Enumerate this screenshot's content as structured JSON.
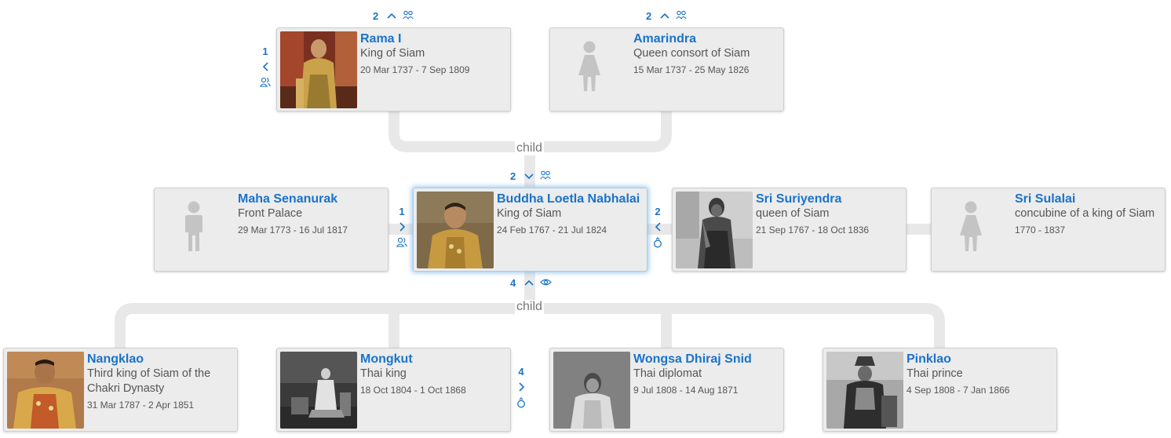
{
  "rel_labels": {
    "top": "child",
    "bottom": "child"
  },
  "controls": {
    "rama_parents_count": "2",
    "amarindra_parents_count": "2",
    "rama_spouses_count": "1",
    "center_parents_count": "2",
    "center_children_count": "4",
    "center_spouse_left_count": "1",
    "center_spouse_right_count": "2",
    "mongkut_spouses_count": "4"
  },
  "cards": {
    "rama": {
      "name": "Rama I",
      "desc": "King of Siam",
      "dates": "20 Mar 1737 - 7 Sep 1809"
    },
    "amarindra": {
      "name": "Amarindra",
      "desc": "Queen consort of Siam",
      "dates": "15 Mar 1737 - 25 May 1826"
    },
    "senanurak": {
      "name": "Maha Senanurak",
      "desc": "Front Palace",
      "dates": "29 Mar 1773 - 16 Jul 1817"
    },
    "buddha": {
      "name": "Buddha Loetla Nabhalai",
      "desc": "King of Siam",
      "dates": "24 Feb 1767 - 21 Jul 1824"
    },
    "suriyendra": {
      "name": "Sri Suriyendra",
      "desc": "queen of Siam",
      "dates": "21 Sep 1767 - 18 Oct 1836"
    },
    "sulalai": {
      "name": "Sri Sulalai",
      "desc": "concubine of a king of Siam",
      "dates": "1770 - 1837"
    },
    "nangklao": {
      "name": "Nangklao",
      "desc": "Third king of Siam of the Chakri Dynasty",
      "dates": "31 Mar 1787 - 2 Apr 1851"
    },
    "mongkut": {
      "name": "Mongkut",
      "desc": "Thai king",
      "dates": "18 Oct 1804 - 1 Oct 1868"
    },
    "wongsa": {
      "name": "Wongsa Dhiraj Snid",
      "desc": "Thai diplomat",
      "dates": "9 Jul 1808 - 14 Aug 1871"
    },
    "pinklao": {
      "name": "Pinklao",
      "desc": "Thai prince",
      "dates": "4 Sep 1808 - 7 Jan 1866"
    }
  },
  "colors": {
    "link": "#1a73c9",
    "card_bg": "#ececec",
    "connector": "#e8e8e8",
    "silhouette": "#c4c4c4"
  },
  "icons": [
    "chevron-up-icon",
    "chevron-down-icon",
    "chevron-left-icon",
    "chevron-right-icon",
    "parents-icon",
    "spouses-icon",
    "ring-icon",
    "eye-icon",
    "female-silhouette-icon",
    "male-silhouette-icon"
  ]
}
